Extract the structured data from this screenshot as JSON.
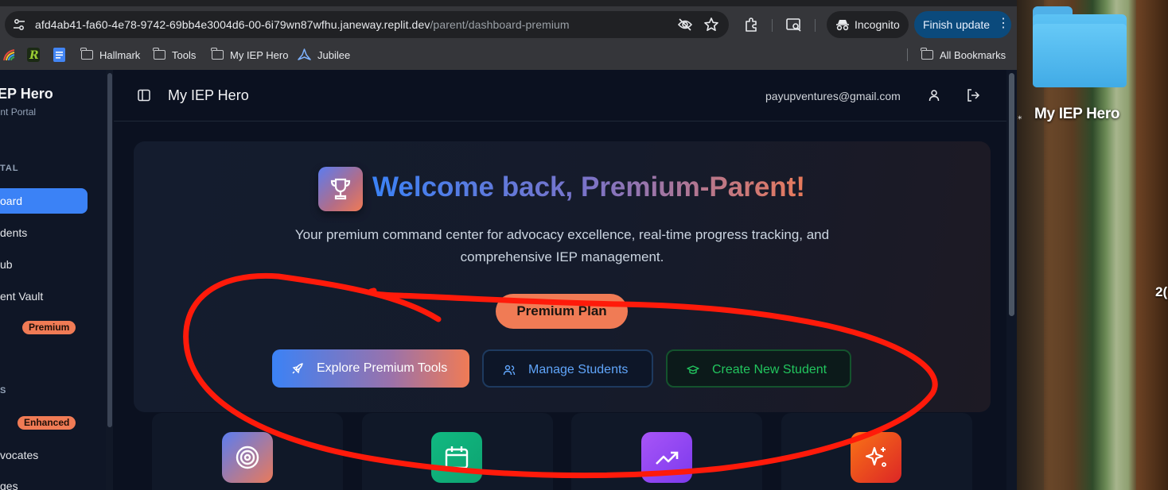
{
  "browser": {
    "url_host": "afd4ab41-fa60-4e78-9742-69bb4e3004d6-00-6i79wn87wfhu.janeway.replit.dev",
    "url_path": "/parent/dashboard-premium",
    "incognito_label": "Incognito",
    "update_label": "Finish update",
    "bookmarks": [
      "Hallmark",
      "Tools",
      "My IEP Hero",
      "Jubilee"
    ],
    "all_bookmarks_label": "All Bookmarks"
  },
  "desktop": {
    "folder_label": "My IEP Hero",
    "clipped_text": "2("
  },
  "sidebar": {
    "app_title_visible": "P Hero",
    "app_subtitle_visible": "ortal",
    "section_portal": "TAL",
    "section_second": "S",
    "items": [
      {
        "label": "oard",
        "active": true
      },
      {
        "label": "dents"
      },
      {
        "label": "ub"
      },
      {
        "label": "ent Vault"
      },
      {
        "label": "",
        "badge": "Premium"
      },
      {
        "label": "",
        "badge": "Enhanced"
      },
      {
        "label": "vocates"
      },
      {
        "label": "ges"
      }
    ]
  },
  "header": {
    "title": "My IEP Hero",
    "email": "payupventures@gmail.com"
  },
  "hero": {
    "welcome": "Welcome back, Premium-Parent!",
    "description": "Your premium command center for advocacy excellence, real-time progress tracking, and comprehensive IEP management.",
    "plan_label": "Premium Plan",
    "buttons": {
      "explore": "Explore Premium Tools",
      "manage": "Manage Students",
      "create": "Create New Student"
    }
  },
  "cards": [
    {
      "icon": "target-icon",
      "color": "#b06c8f"
    },
    {
      "icon": "calendar-icon",
      "color": "#10b981"
    },
    {
      "icon": "trending-up-icon",
      "color": "#8b5cf6"
    },
    {
      "icon": "sparkles-icon",
      "color": "#ef4444"
    }
  ],
  "colors": {
    "accent_blue": "#3b82f6",
    "accent_orange": "#f07b55",
    "accent_green": "#22c55e",
    "annotation_red": "#ff1a0a"
  }
}
